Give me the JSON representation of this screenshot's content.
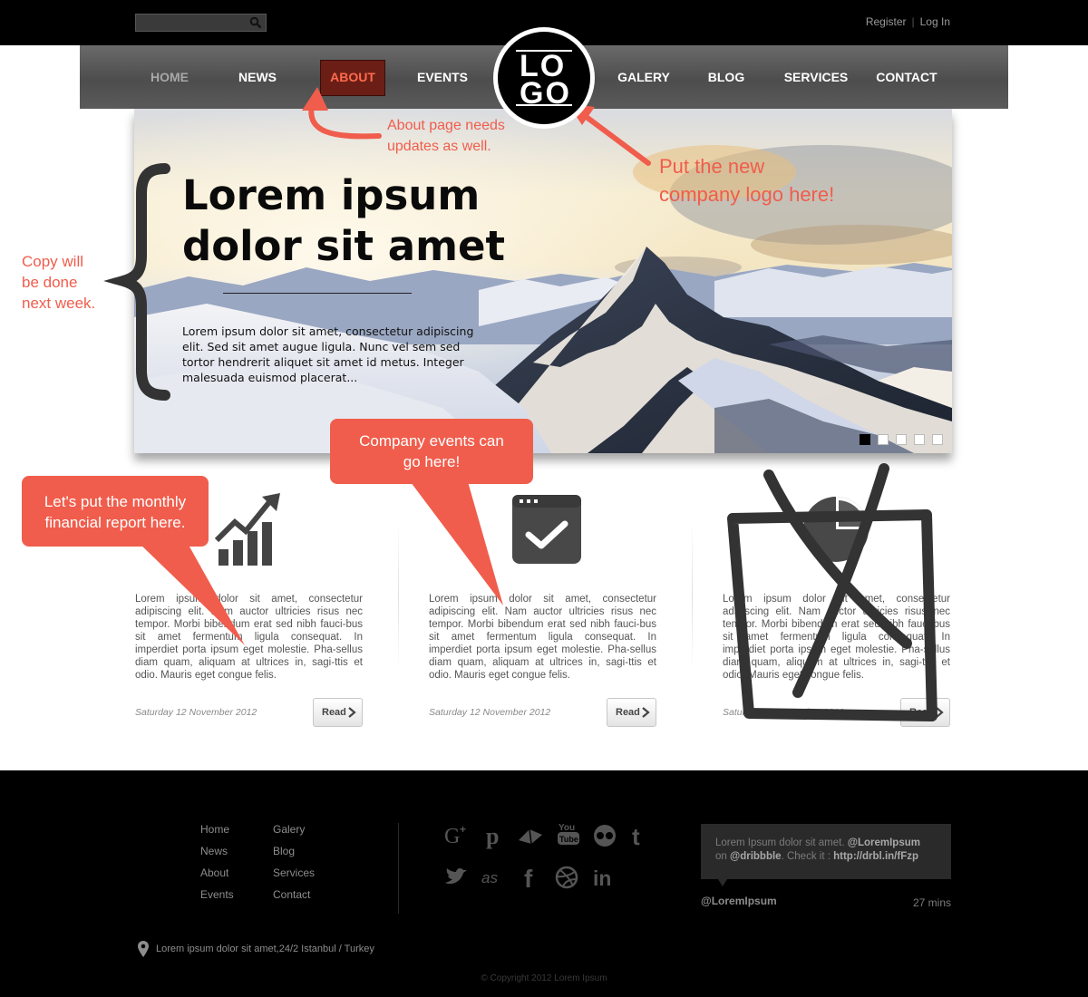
{
  "topbar": {
    "search_placeholder": "",
    "register": "Register",
    "separator": "|",
    "login": "Log In"
  },
  "nav": {
    "items": [
      {
        "label": "HOME",
        "state": "dim"
      },
      {
        "label": "NEWS"
      },
      {
        "label": "ABOUT",
        "state": "active"
      },
      {
        "label": "EVENTS"
      },
      {
        "label": "GALERY"
      },
      {
        "label": "BLOG"
      },
      {
        "label": "SERVICES"
      },
      {
        "label": "CONTACT"
      }
    ],
    "logo_line1": "LO",
    "logo_line2": "GO"
  },
  "hero": {
    "title": "Lorem ipsum dolor sit amet",
    "text": "Lorem ipsum dolor sit amet, consectetur adipiscing elit. Sed sit amet augue ligula. Nunc vel sem sed tortor hendrerit aliquet sit amet id metus. Integer malesuada euismod placerat...",
    "slides": 5,
    "active_slide": 1
  },
  "columns": [
    {
      "icon": "growth-chart-icon",
      "text": "Lorem ipsum dolor sit amet, consectetur adipiscing elit. Nam auctor ultricies risus nec tempor. Morbi bibendum erat sed nibh fauci-bus sit amet fermentum ligula consequat. In imperdiet porta ipsum eget molestie. Pha-sellus diam quam, aliquam at ultrices in, sagi-ttis et odio. Mauris eget congue felis.",
      "date": "Saturday 12 November 2012",
      "button": "Read"
    },
    {
      "icon": "calendar-check-icon",
      "text": "Lorem ipsum dolor sit amet, consectetur adipiscing elit. Nam auctor ultricies risus nec tempor. Morbi bibendum erat sed nibh fauci-bus sit amet fermentum ligula consequat. In imperdiet porta ipsum eget molestie. Pha-sellus diam quam, aliquam at ultrices in, sagi-ttis et odio. Mauris eget congue felis.",
      "date": "Saturday 12 November 2012",
      "button": "Read"
    },
    {
      "icon": "pie-chart-icon",
      "text": "Lorem ipsum dolor sit amet, consectetur adipiscing elit. Nam auctor ultricies risus nec tempor. Morbi bibendum erat sed nibh fauci-bus sit amet fermentum ligula consequat. In imperdiet porta ipsum eget molestie. Pha-sellus diam quam, aliquam at ultrices in, sagi-ttis et odio. Mauris eget congue felis.",
      "date": "Saturday 12 November 2012",
      "button": "Read"
    }
  ],
  "footer": {
    "links_col1": [
      "Home",
      "News",
      "About",
      "Events"
    ],
    "links_col2": [
      "Galery",
      "Blog",
      "Services",
      "Contact"
    ],
    "social": [
      "google-plus-icon",
      "pinterest-icon",
      "delicious-icon",
      "youtube-icon",
      "flickr-icon",
      "tumblr-icon",
      "twitter-icon",
      "lastfm-icon",
      "facebook-icon",
      "dribbble-icon",
      "linkedin-icon"
    ],
    "tweet": {
      "text1": "Lorem Ipsum dolor sit amet.",
      "mention1": "@LoremIpsum",
      "text2": "on",
      "mention2": "@dribbble",
      "text3": ". Check it :",
      "link": "http://drbl.in/fFzp",
      "handle": "@LoremIpsum",
      "time": "27 mins"
    },
    "address": "Lorem ipsum dolor sit amet,24/2  Istanbul / Turkey",
    "copyright": "© Copyright 2012 Lorem Ipsum"
  },
  "annotations": {
    "about_note": [
      "About page needs",
      "updates as well."
    ],
    "logo_note": [
      "Put the new",
      "company logo here!"
    ],
    "copy_note": [
      "Copy will",
      "be done",
      "next week."
    ],
    "report_bubble": [
      "Let's put the monthly",
      "financial report here."
    ],
    "events_bubble": [
      "Company events can",
      "go here!"
    ],
    "color": "#f05d4c"
  }
}
